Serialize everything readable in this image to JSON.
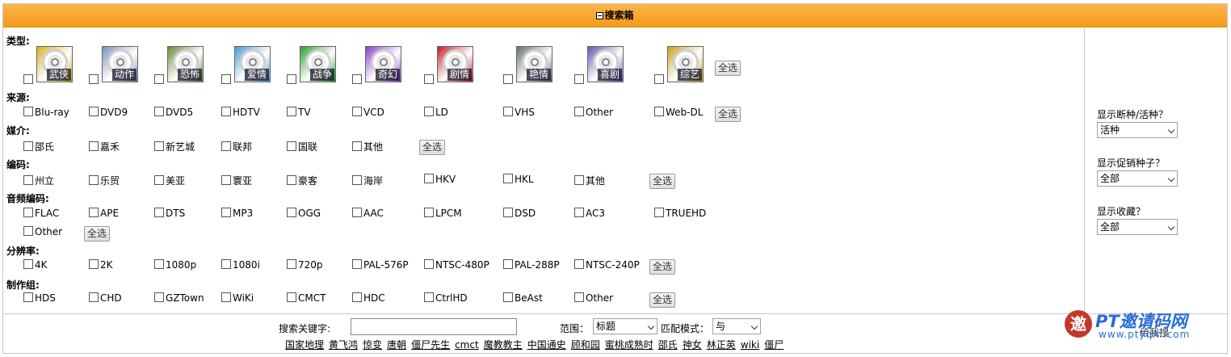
{
  "header": {
    "title": "搜索箱"
  },
  "categories": {
    "type": {
      "label": "类型:",
      "select_all": "全选",
      "items": [
        {
          "name": "武侠",
          "color": "#d6b020"
        },
        {
          "name": "动作",
          "color": "#7a8fb8"
        },
        {
          "name": "恐怖",
          "color": "#6a8a3a"
        },
        {
          "name": "爱情",
          "color": "#4a9ad0"
        },
        {
          "name": "战争",
          "color": "#2aa02a"
        },
        {
          "name": "奇幻",
          "color": "#8a40c8"
        },
        {
          "name": "剧情",
          "color": "#c02020"
        },
        {
          "name": "艳情",
          "color": "#607070"
        },
        {
          "name": "喜剧",
          "color": "#6a50b0"
        },
        {
          "name": "综艺",
          "color": "#c8a020"
        }
      ]
    },
    "source": {
      "label": "来源:",
      "select_all": "全选",
      "items": [
        "Blu-ray",
        "DVD9",
        "DVD5",
        "HDTV",
        "TV",
        "VCD",
        "LD",
        "VHS",
        "Other",
        "Web-DL"
      ]
    },
    "medium": {
      "label": "媒介:",
      "select_all": "全选",
      "items": [
        "邵氏",
        "嘉禾",
        "新艺城",
        "联邦",
        "国联",
        "其他"
      ]
    },
    "codec": {
      "label": "编码:",
      "select_all": "全选",
      "items": [
        "州立",
        "乐贸",
        "美亚",
        "寰亚",
        "豪客",
        "海岸",
        "HKV",
        "HKL",
        "其他"
      ]
    },
    "audio": {
      "label": "音频编码:",
      "select_all": "全选",
      "items": [
        "FLAC",
        "APE",
        "DTS",
        "MP3",
        "OGG",
        "AAC",
        "LPCM",
        "DSD",
        "AC3",
        "TRUEHD",
        "Other"
      ]
    },
    "resolution": {
      "label": "分辨率:",
      "select_all": "全选",
      "items": [
        "4K",
        "2K",
        "1080p",
        "1080i",
        "720p",
        "PAL-576P",
        "NTSC-480P",
        "PAL-288P",
        "NTSC-240P"
      ]
    },
    "team": {
      "label": "制作组:",
      "select_all": "全选",
      "items": [
        "HDS",
        "CHD",
        "GZTown",
        "WiKi",
        "CMCT",
        "HDC",
        "CtrlHD",
        "BeAst",
        "Other"
      ]
    }
  },
  "right_panel": {
    "dead": {
      "label": "显示断种/活种？",
      "value": "活种"
    },
    "promo": {
      "label": "显示促销种子？",
      "value": "全部"
    },
    "bookmark": {
      "label": "显示收藏？",
      "value": "全部"
    }
  },
  "search": {
    "keyword_label": "搜索关键字:",
    "keyword_value": "",
    "scope_label": "范围：",
    "scope_value": "标题",
    "mode_label": "匹配模式：",
    "mode_value": "与",
    "submit_label": "给我搜",
    "hot": [
      "国家地理",
      "黄飞鸿",
      "惊变",
      "唐朝",
      "僵尸先生",
      "cmct",
      "魔教教主",
      "中国通史",
      "顾和园",
      "蜜桃成熟时",
      "邵氏",
      "神女",
      "林正英",
      "wiki",
      "僵尸"
    ]
  },
  "watermark": {
    "title": "PT邀请码网",
    "url": "www.ptyqm.com",
    "logo_char": "邀"
  }
}
